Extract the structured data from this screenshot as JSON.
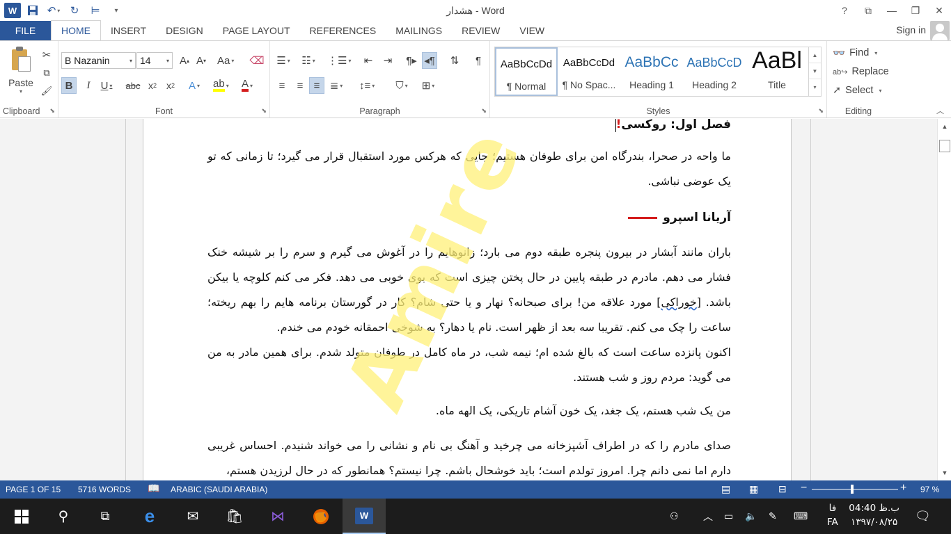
{
  "window": {
    "title": "هشدار - Word"
  },
  "qat": {
    "save": "save-icon",
    "undo": "undo-icon",
    "redo": "redo-icon"
  },
  "tabs": [
    "FILE",
    "HOME",
    "INSERT",
    "DESIGN",
    "PAGE LAYOUT",
    "REFERENCES",
    "MAILINGS",
    "REVIEW",
    "VIEW"
  ],
  "signin": "Sign in",
  "ribbon": {
    "clipboard": {
      "label": "Clipboard",
      "paste": "Paste"
    },
    "font": {
      "label": "Font",
      "name": "B Nazanin",
      "size": "14"
    },
    "paragraph": {
      "label": "Paragraph"
    },
    "styles": {
      "label": "Styles",
      "items": [
        {
          "sample": "AaBbCcDd",
          "name": "¶ Normal"
        },
        {
          "sample": "AaBbCcDd",
          "name": "¶ No Spac..."
        },
        {
          "sample": "AaBbCc",
          "name": "Heading 1"
        },
        {
          "sample": "AaBbCcD",
          "name": "Heading 2"
        },
        {
          "sample": "AaBl",
          "name": "Title"
        }
      ]
    },
    "editing": {
      "label": "Editing",
      "find": "Find",
      "replace": "Replace",
      "select": "Select"
    }
  },
  "document": {
    "heading_prefix": "فصل اول: ",
    "heading_name": "روکسی",
    "heading_mark": "!",
    "quote": "ما واحه در صحرا، بندرگاه امن برای طوفان هستیم؛ جایی که هرکس مورد استقبال قرار می گیرد؛ تا زمانی که تو یک عوضی نباشی.",
    "author": "آریانا اسپرو",
    "para1_a": "باران مانند آبشار در بیرون پنجره طبقه دوم می بارد؛ زانوهایم را در آغوش می گیرم و سرم را بر شیشه خنک فشار می دهم. مادرم در طبقه پایین در حال پختن چیزی است که بوی خوبی می دهد. فکر می کنم کلوچه یا بیکن باشد. [",
    "para1_spell": "خوراکی",
    "para1_b": "] مورد علاقه من! برای صبحانه؟ نهار و یا حتی شام؟ کار در گورستان برنامه هایم را بهم ریخته؛ ساعت را چک می کنم. تقریبا سه بعد از ظهر است. نام یا دهار؟ به شوخی احمقانه خودم می خندم.",
    "para2": "اکنون پانزده ساعت است که بالغ شده ام؛ نیمه شب، در ماه کامل در طوفان متولد شدم. برای همین مادر به من می گوید: مردم روز و شب هستند.",
    "para3": "من یک شب هستم، یک جغد، یک خون آشام تاریکی، یک الهه ماه.",
    "para4": "صدای مادرم را که در اطراف آشپزخانه می چرخید و آهنگ بی نام و نشانی را می خواند شنیدم. احساس غریبی دارم اما نمی دانم چرا. امروز تولدم است؛ باید خوشحال باشم. چرا نیستم؟ همانطور که در حال لرزیدن هستم،",
    "watermark": "Amire Girl"
  },
  "status": {
    "page": "PAGE 1 OF 15",
    "words": "5716 WORDS",
    "language": "ARABIC (SAUDI ARABIA)",
    "zoom": "97 %",
    "zoom_level": 0.47
  },
  "taskbar": {
    "time": "04:40 ب.ظ",
    "date": "۱۳۹۷/۰۸/۲۵",
    "lang_top": "فا",
    "lang_bottom": "FA"
  },
  "colors": {
    "accent": "#2b579a",
    "heading_red": "#d41e1e",
    "watermark": "#fff078"
  }
}
